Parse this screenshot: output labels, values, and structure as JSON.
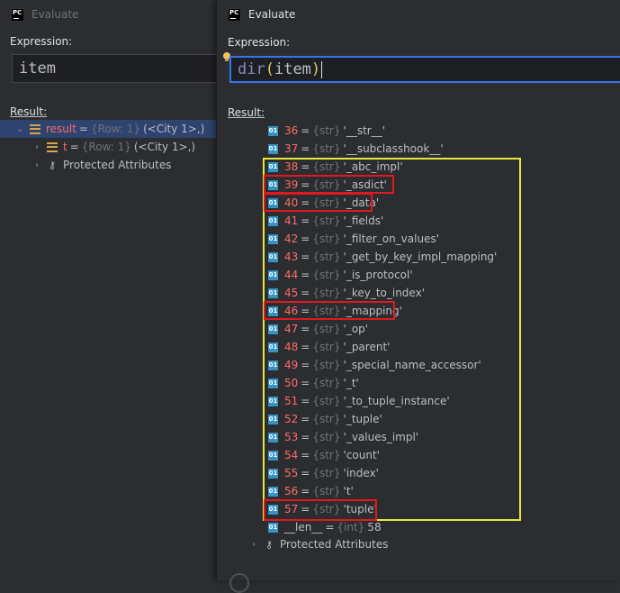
{
  "back_window": {
    "title": "Evaluate",
    "expression_label": "Expression:",
    "expression_value": "item",
    "result_label": "Result:",
    "tree": [
      {
        "key": "result",
        "type": "{Row: 1}",
        "value": "(<City 1>,)"
      },
      {
        "key": "t",
        "type": "{Row: 1}",
        "value": "(<City 1>,)"
      },
      {
        "label": "Protected Attributes"
      }
    ]
  },
  "front_window": {
    "title": "Evaluate",
    "expression_label": "Expression:",
    "expression": {
      "func": "dir",
      "open": "(",
      "arg": "item",
      "close": ")"
    },
    "result_label": "Result:",
    "number_icon": "01",
    "items": [
      {
        "index": "36",
        "type": "{str}",
        "value": "'__str__'"
      },
      {
        "index": "37",
        "type": "{str}",
        "value": "'__subclasshook__'"
      },
      {
        "index": "38",
        "type": "{str}",
        "value": "'_abc_impl'"
      },
      {
        "index": "39",
        "type": "{str}",
        "value": "'_asdict'"
      },
      {
        "index": "40",
        "type": "{str}",
        "value": "'_data'"
      },
      {
        "index": "41",
        "type": "{str}",
        "value": "'_fields'"
      },
      {
        "index": "42",
        "type": "{str}",
        "value": "'_filter_on_values'"
      },
      {
        "index": "43",
        "type": "{str}",
        "value": "'_get_by_key_impl_mapping'"
      },
      {
        "index": "44",
        "type": "{str}",
        "value": "'_is_protocol'"
      },
      {
        "index": "45",
        "type": "{str}",
        "value": "'_key_to_index'"
      },
      {
        "index": "46",
        "type": "{str}",
        "value": "'_mapping'"
      },
      {
        "index": "47",
        "type": "{str}",
        "value": "'_op'"
      },
      {
        "index": "48",
        "type": "{str}",
        "value": "'_parent'"
      },
      {
        "index": "49",
        "type": "{str}",
        "value": "'_special_name_accessor'"
      },
      {
        "index": "50",
        "type": "{str}",
        "value": "'_t'"
      },
      {
        "index": "51",
        "type": "{str}",
        "value": "'_to_tuple_instance'"
      },
      {
        "index": "52",
        "type": "{str}",
        "value": "'_tuple'"
      },
      {
        "index": "53",
        "type": "{str}",
        "value": "'_values_impl'"
      },
      {
        "index": "54",
        "type": "{str}",
        "value": "'count'"
      },
      {
        "index": "55",
        "type": "{str}",
        "value": "'index'"
      },
      {
        "index": "56",
        "type": "{str}",
        "value": "'t'"
      },
      {
        "index": "57",
        "type": "{str}",
        "value": "'tuple'"
      }
    ],
    "len_item": {
      "key": "__len__",
      "type": "{int}",
      "value": "58"
    },
    "protected_label": "Protected Attributes"
  },
  "colors": {
    "highlight_yellow": "#e8e83c",
    "highlight_red": "#e1191e",
    "selection": "#2e436e",
    "index_red": "#ff6b68"
  }
}
